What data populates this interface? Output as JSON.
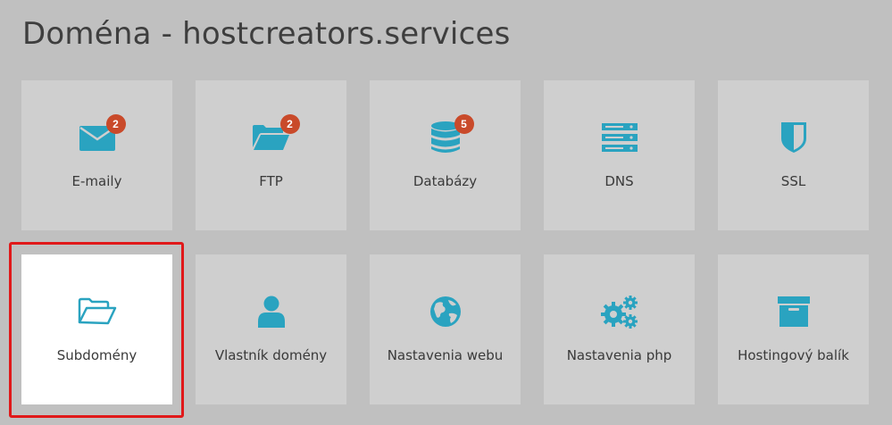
{
  "page": {
    "title": "Doména - hostcreators.services"
  },
  "colors": {
    "background": "#c0c0c0",
    "tile": "#cfcfcf",
    "tile_active": "#ffffff",
    "icon": "#2aa3c0",
    "badge": "#c94a2a",
    "highlight": "#e0191a"
  },
  "tiles": [
    {
      "label": "E-maily",
      "icon": "envelope-icon",
      "badge": "2"
    },
    {
      "label": "FTP",
      "icon": "folder-open-icon",
      "badge": "2"
    },
    {
      "label": "Databázy",
      "icon": "database-icon",
      "badge": "5"
    },
    {
      "label": "DNS",
      "icon": "server-icon"
    },
    {
      "label": "SSL",
      "icon": "shield-icon"
    },
    {
      "label": "Subdomény",
      "icon": "folder-open-outline-icon",
      "active": true
    },
    {
      "label": "Vlastník domény",
      "icon": "user-icon"
    },
    {
      "label": "Nastavenia webu",
      "icon": "globe-icon"
    },
    {
      "label": "Nastavenia php",
      "icon": "gears-icon"
    },
    {
      "label": "Hostingový balík",
      "icon": "archive-box-icon"
    }
  ]
}
